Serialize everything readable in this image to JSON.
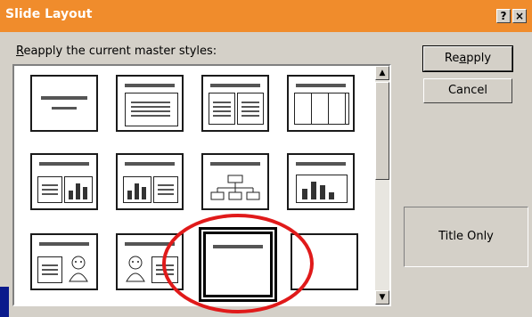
{
  "window": {
    "title": "Slide Layout"
  },
  "titlebar_buttons": {
    "help": "?",
    "close": "×"
  },
  "prompt": {
    "accesskey": "R",
    "rest": "eapply the current master styles:"
  },
  "buttons": {
    "reapply": {
      "label_pre": "Re",
      "accesskey": "a",
      "label_post": "pply"
    },
    "cancel": "Cancel"
  },
  "preview": {
    "label": "Title Only"
  },
  "layouts": [
    {
      "id": "title-slide"
    },
    {
      "id": "bulleted-list"
    },
    {
      "id": "two-column-text"
    },
    {
      "id": "table"
    },
    {
      "id": "text-and-chart"
    },
    {
      "id": "chart-and-text"
    },
    {
      "id": "organization-chart"
    },
    {
      "id": "chart"
    },
    {
      "id": "text-and-clip-art"
    },
    {
      "id": "clip-art-and-text"
    },
    {
      "id": "title-only",
      "selected": true
    },
    {
      "id": "blank"
    }
  ],
  "colors": {
    "titlebar": "#f08c2c",
    "highlight": "#e01a1a"
  }
}
